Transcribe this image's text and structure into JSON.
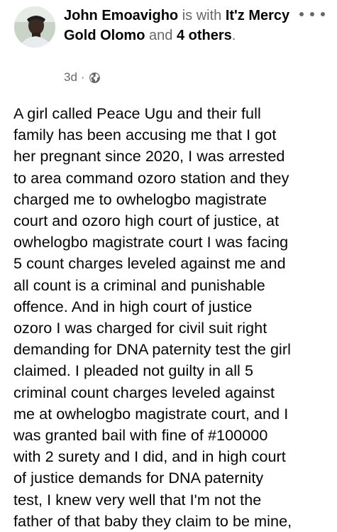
{
  "post": {
    "author": "John Emoavigho",
    "with_text": "is with",
    "tagged_person": "It'z Mercy Gold Olomo",
    "and_text": "and",
    "others": "4 others",
    "period": ".",
    "time": "3d",
    "separator": "·",
    "privacy_icon": "globe-icon",
    "more_icon": "more-options-icon",
    "body": "A girl called Peace Ugu and their full\nfamily has been accusing me that I got\nher pregnant since  2020, I was arrested\nto area command ozoro station and they\ncharged me to owhelogbo magistrate\ncourt and ozoro high court of justice, at\nowhelogbo magistrate court I was facing\n5 count charges leveled against me and\nall count is a criminal and punishable\noffence. And in high court of justice\nozoro I was charged for civil suit right\ndemanding for DNA paternity test the girl\nclaimed. I pleaded not guilty in all 5\ncriminal count charges leveled against\nme at owhelogbo magistrate court, and I\nwas granted bail with fine of  #100000\nwith 2 surety and I did, and in high court\nof justice demands for DNA paternity\ntest, I knew very well that I'm not the\nfather of that baby they claim to be mine,"
  },
  "colors": {
    "text_primary": "#050505",
    "text_secondary": "#65676b",
    "background": "#ffffff"
  }
}
